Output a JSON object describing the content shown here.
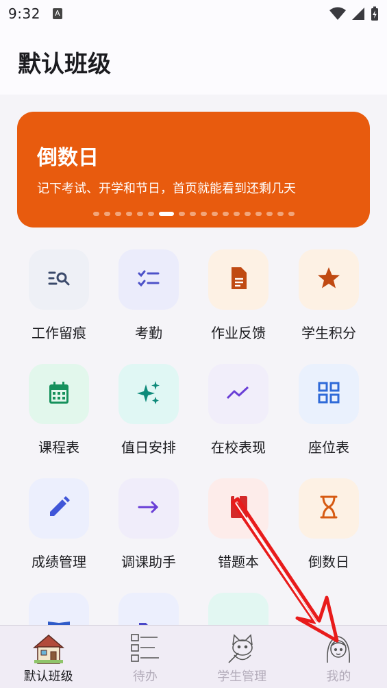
{
  "status": {
    "time": "9:32",
    "a_badge": "A"
  },
  "header": {
    "title": "默认班级"
  },
  "banner": {
    "title": "倒数日",
    "subtitle": "记下考试、开学和节日，首页就能看到还剩几天",
    "active_dot": 6,
    "dot_count": 18,
    "color": "#e85b0e"
  },
  "grid": [
    {
      "label": "工作留痕",
      "icon": "search-list-icon",
      "bg": "#eef0f6",
      "fg": "#3b4a6b"
    },
    {
      "label": "考勤",
      "icon": "checklist-icon",
      "bg": "#ebecfb",
      "fg": "#4d52c8"
    },
    {
      "label": "作业反馈",
      "icon": "document-icon",
      "bg": "#fdf1e4",
      "fg": "#c04a12"
    },
    {
      "label": "学生积分",
      "icon": "star-icon",
      "bg": "#fdf1e4",
      "fg": "#c04a12"
    },
    {
      "label": "课程表",
      "icon": "calendar-icon",
      "bg": "#e2f7ec",
      "fg": "#16915c"
    },
    {
      "label": "值日安排",
      "icon": "sparkles-icon",
      "bg": "#e0f7f4",
      "fg": "#0e8a7a"
    },
    {
      "label": "在校表现",
      "icon": "trend-icon",
      "bg": "#f1eefa",
      "fg": "#6a3fd6"
    },
    {
      "label": "座位表",
      "icon": "grid-icon",
      "bg": "#eaf1fd",
      "fg": "#2f6ad8"
    },
    {
      "label": "成绩管理",
      "icon": "pencil-icon",
      "bg": "#eceffd",
      "fg": "#4056d8"
    },
    {
      "label": "调课助手",
      "icon": "arrow-right-icon",
      "bg": "#f0edfa",
      "fg": "#6a3fd6"
    },
    {
      "label": "错题本",
      "icon": "book-icon",
      "bg": "#fdecea",
      "fg": "#d42a2a"
    },
    {
      "label": "倒数日",
      "icon": "hourglass-icon",
      "bg": "#fdf1e4",
      "fg": "#d65a12"
    },
    {
      "label": "",
      "icon": "open-book-icon",
      "bg": "#eceffd",
      "fg": "#2f5bc8"
    },
    {
      "label": "",
      "icon": "folder-icon",
      "bg": "#eceffd",
      "fg": "#4a48c8"
    },
    {
      "label": "",
      "icon": "dots-icon",
      "bg": "#e2f7f2",
      "fg": "#0e8a6a"
    }
  ],
  "nav": [
    {
      "label": "默认班级",
      "icon": "house-icon",
      "active": true
    },
    {
      "label": "待办",
      "icon": "todo-list-icon",
      "active": false
    },
    {
      "label": "学生管理",
      "icon": "cat-student-icon",
      "active": false
    },
    {
      "label": "我的",
      "icon": "girl-avatar-icon",
      "active": false
    }
  ],
  "annotation": {
    "type": "red-arrow",
    "color": "#e81b1b",
    "points_to": "我的"
  }
}
